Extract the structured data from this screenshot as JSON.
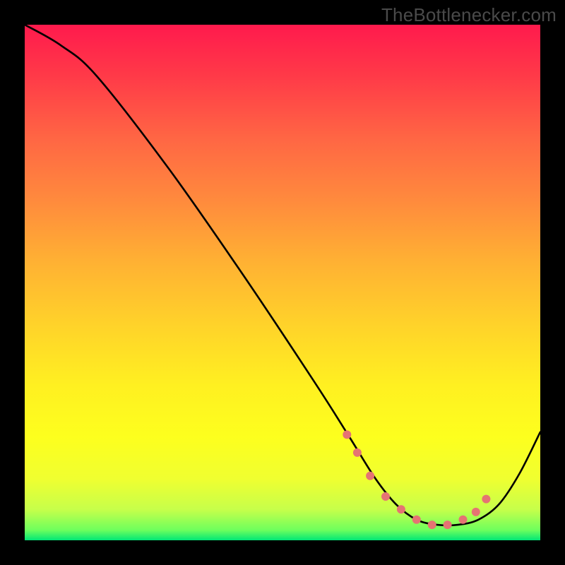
{
  "watermark": "TheBottlenecker.com",
  "chart_data": {
    "type": "line",
    "title": "",
    "xlabel": "",
    "ylabel": "",
    "xlim": [
      0,
      100
    ],
    "ylim": [
      0,
      100
    ],
    "series": [
      {
        "name": "bottleneck-curve",
        "x": [
          0,
          7,
          14,
          28,
          42,
          56,
          63,
          68,
          72,
          76,
          80,
          84,
          88,
          92,
          96,
          100
        ],
        "values": [
          100,
          96,
          90,
          72,
          52,
          31,
          20,
          12,
          7,
          4,
          3,
          3,
          4,
          7,
          13,
          21
        ]
      }
    ],
    "markers": {
      "name": "highlight-dots",
      "color": "#e57373",
      "x": [
        62.5,
        64.5,
        67,
        70,
        73,
        76,
        79,
        82,
        85,
        87.5,
        89.5
      ],
      "values": [
        20.5,
        17,
        12.5,
        8.5,
        6,
        4,
        3,
        3,
        4,
        5.5,
        8
      ]
    }
  }
}
